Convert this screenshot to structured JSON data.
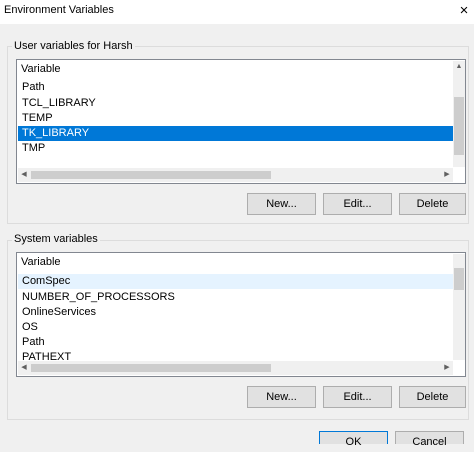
{
  "window": {
    "title": "Environment Variables",
    "close_glyph": "×"
  },
  "user_section": {
    "label": "User variables for Harsh",
    "header": "Variable",
    "rows": [
      "Path",
      "TCL_LIBRARY",
      "TEMP",
      "TK_LIBRARY",
      "TMP"
    ],
    "selected_row": "TK_LIBRARY",
    "buttons": {
      "new": "New...",
      "edit": "Edit...",
      "delete": "Delete"
    }
  },
  "system_section": {
    "label": "System variables",
    "header": "Variable",
    "rows": [
      "ComSpec",
      "NUMBER_OF_PROCESSORS",
      "OnlineServices",
      "OS",
      "Path",
      "PATHEXT"
    ],
    "buttons": {
      "new": "New...",
      "edit": "Edit...",
      "delete": "Delete"
    }
  },
  "footer": {
    "ok": "OK",
    "cancel": "Cancel"
  },
  "icons": {
    "up": "up-arrow-icon",
    "down": "down-arrow-icon",
    "left": "left-arrow-icon",
    "right": "right-arrow-icon"
  },
  "colors": {
    "selection": "#0078d7",
    "background": "#f0f0f0"
  }
}
